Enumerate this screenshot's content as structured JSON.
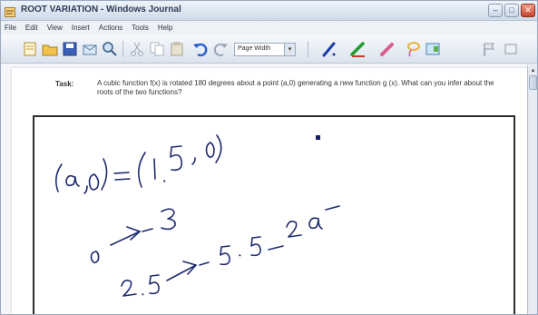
{
  "window": {
    "title": "ROOT VARIATION - Windows Journal",
    "controls": {
      "minimize": "–",
      "maximize": "□",
      "close": "✕"
    }
  },
  "menu": [
    "File",
    "Edit",
    "View",
    "Insert",
    "Actions",
    "Tools",
    "Help"
  ],
  "toolbar": {
    "zoom_value": "Page Width",
    "zoom_arrow": "▾",
    "icons": [
      "new-note-icon",
      "open-icon",
      "save-icon",
      "send-icon",
      "find-icon",
      "cut-icon",
      "copy-icon",
      "paste-icon",
      "undo-icon",
      "redo-icon",
      "pen-icon",
      "highlighter-icon",
      "eraser-icon",
      "lasso-icon",
      "insert-space-icon",
      "flag-icon"
    ],
    "colors": {
      "pen": "#1d3fa8",
      "highlighter": "#1f9a2e",
      "eraser": "#d9608e",
      "lasso": "#e8b23a"
    }
  },
  "task": {
    "label": "Task:",
    "text": "A cubic function f(x) is rotated 180 degrees about a point (a,0) generating a new function g (x). What can you infer about the roots of the two functions?"
  },
  "handwriting": {
    "lines": [
      "(a,0) = (1.5, 0)",
      "0 → -3",
      "2.5 → -5.5 _ 2a"
    ],
    "ink_color": "#1d2a6e"
  },
  "scrollbar": {
    "up_arrow": "▴"
  }
}
